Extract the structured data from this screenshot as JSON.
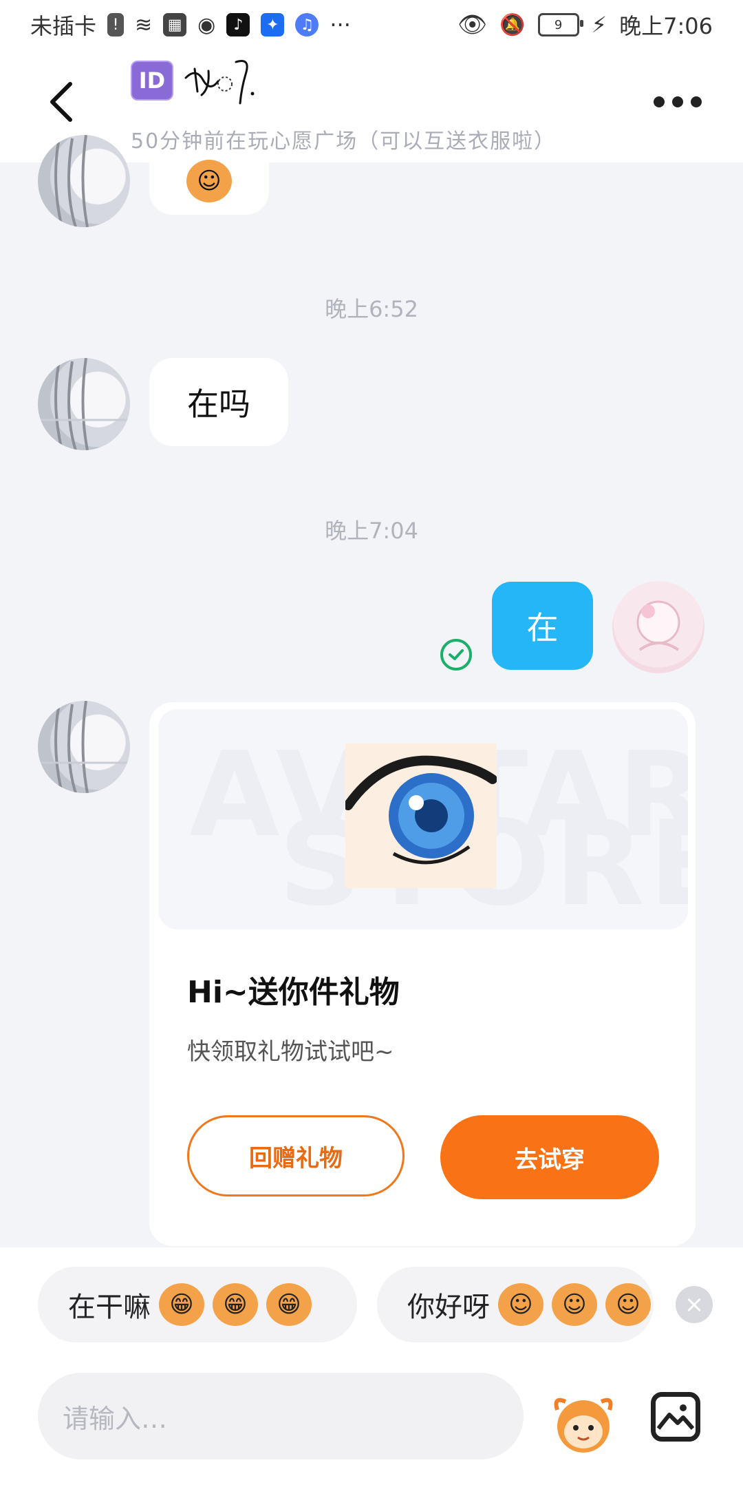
{
  "status_bar": {
    "carrier": "未插卡",
    "battery": "9",
    "time": "晚上7:06"
  },
  "header": {
    "id_badge": "ID",
    "subtitle": "50分钟前在玩心愿广场（可以互送衣服啦）"
  },
  "messages": {
    "time_1": "晚上6:52",
    "text_1": "在吗",
    "time_2": "晚上7:04",
    "sent_1": "在"
  },
  "gift_card": {
    "watermark_1": "AVATAR",
    "watermark_2": "STORE",
    "title": "Hi~送你件礼物",
    "subtitle": "快领取礼物试试吧~",
    "btn_return": "回赠礼物",
    "btn_try": "去试穿"
  },
  "quick_replies": [
    {
      "label": "在干嘛"
    },
    {
      "label": "你好呀"
    }
  ],
  "composer": {
    "placeholder": "请输入…"
  },
  "colors": {
    "accent_orange": "#f97316",
    "sent_blue": "#24b6f6",
    "check_green": "#1ab06a"
  }
}
